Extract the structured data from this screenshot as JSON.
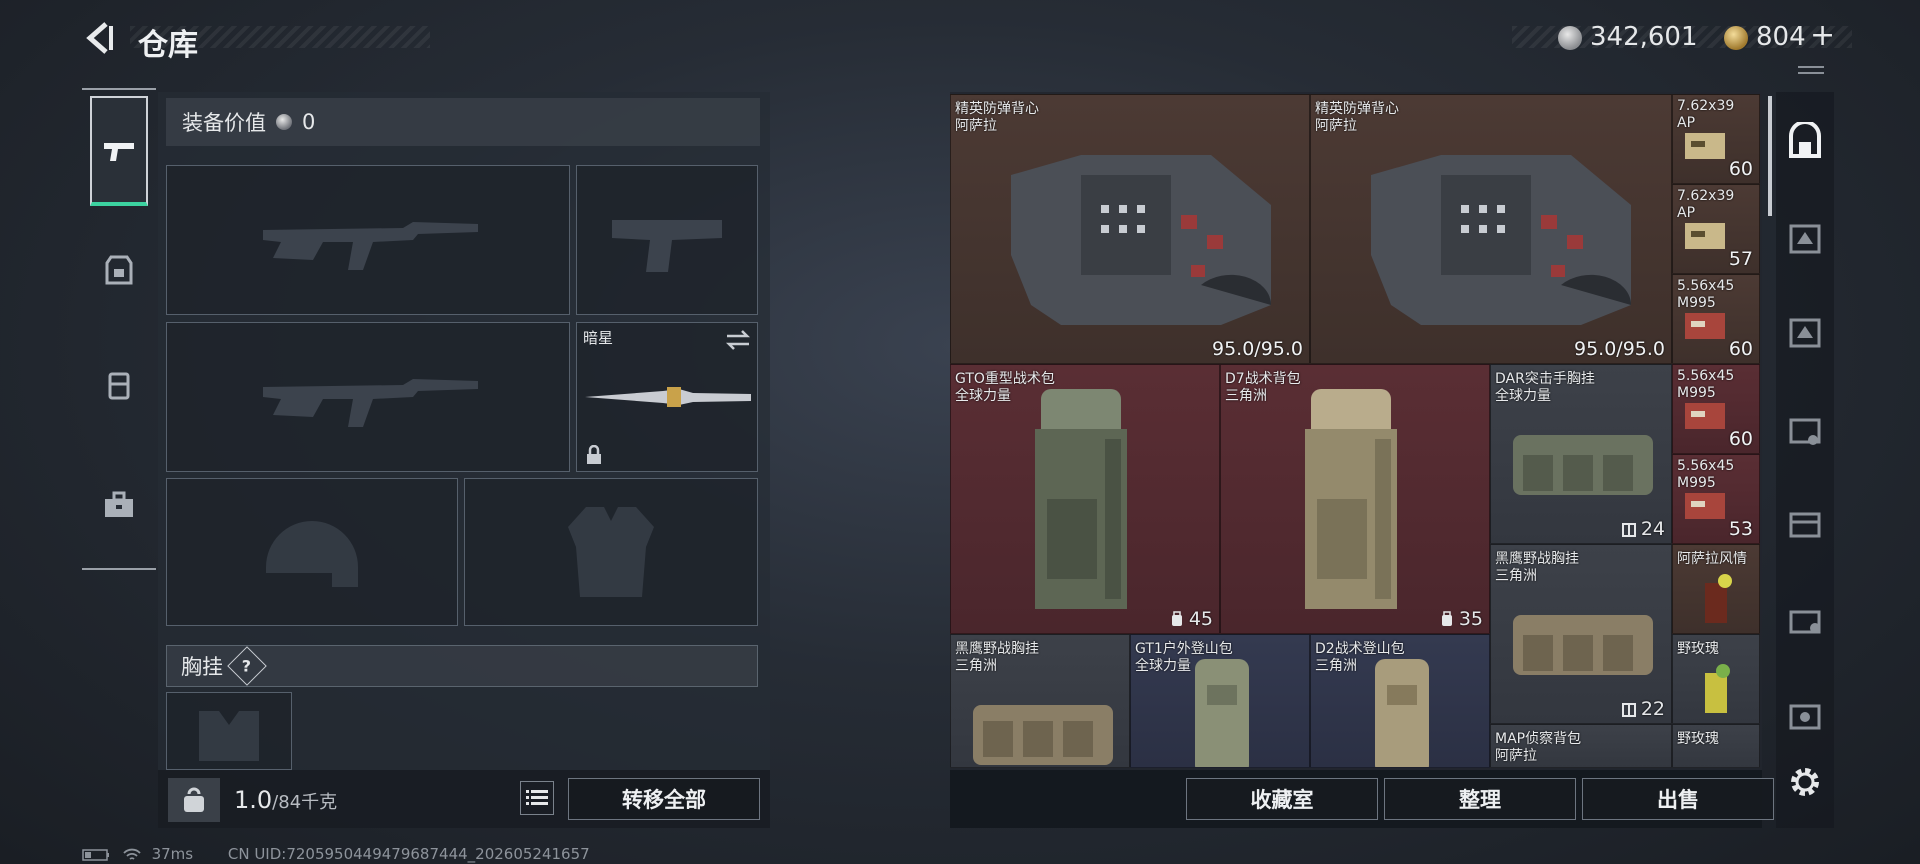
{
  "header": {
    "title": "仓库",
    "currency_silver": "342,601",
    "currency_gold": "804",
    "plus_label": "+"
  },
  "left_panel": {
    "value_label": "装备价值",
    "value_amount": "0",
    "melee_name": "暗星",
    "chest_section_label": "胸挂",
    "help_label": "?",
    "weight_current": "1.0",
    "weight_max": "/84千克",
    "transfer_all_label": "转移全部"
  },
  "grid": {
    "items": [
      {
        "name": "精英防弹背心",
        "sub": "阿萨拉",
        "value": "95.0/95.0"
      },
      {
        "name": "精英防弹背心",
        "sub": "阿萨拉",
        "value": "95.0/95.0"
      },
      {
        "name": "7.62x39",
        "sub": "AP",
        "value": "60"
      },
      {
        "name": "7.62x39",
        "sub": "AP",
        "value": "57"
      },
      {
        "name": "5.56x45",
        "sub": "M995",
        "value": "60"
      },
      {
        "name": "GTO重型战术包",
        "sub": "全球力量",
        "value": "45"
      },
      {
        "name": "D7战术背包",
        "sub": "三角洲",
        "value": "35"
      },
      {
        "name": "DAR突击手胸挂",
        "sub": "全球力量",
        "value": "24"
      },
      {
        "name": "5.56x45",
        "sub": "M995",
        "value": "60"
      },
      {
        "name": "5.56x45",
        "sub": "M995",
        "value": "53"
      },
      {
        "name": "黑鹰野战胸挂",
        "sub": "三角洲",
        "value": "22"
      },
      {
        "name": "阿萨拉风情",
        "sub": "",
        "value": ""
      },
      {
        "name": "野玫瑰",
        "sub": "",
        "value": ""
      },
      {
        "name": "黑鹰野战胸挂",
        "sub": "三角洲",
        "value": ""
      },
      {
        "name": "GT1户外登山包",
        "sub": "全球力量",
        "value": ""
      },
      {
        "name": "D2战术登山包",
        "sub": "三角洲",
        "value": ""
      },
      {
        "name": "MAP侦察背包",
        "sub": "阿萨拉",
        "value": ""
      },
      {
        "name": "野玫瑰",
        "sub": "",
        "value": ""
      }
    ]
  },
  "bottom_buttons": {
    "collection": "收藏室",
    "organize": "整理",
    "sell": "出售"
  },
  "status": {
    "ping": "37ms",
    "uid": "CN UID:7205950449479687444_202605241657"
  },
  "colors": {
    "accent": "#3cd2a0",
    "cell_brown": "#4c3a34",
    "cell_red": "#5a2e34",
    "cell_navy": "#343a50"
  },
  "icons": {
    "back": "back-arrow-icon",
    "tab_weapons": "pistol-icon",
    "tab_armor": "armor-icon",
    "tab_backpack": "backpack-icon",
    "tab_case": "briefcase-icon",
    "settings": "gear-icon"
  }
}
